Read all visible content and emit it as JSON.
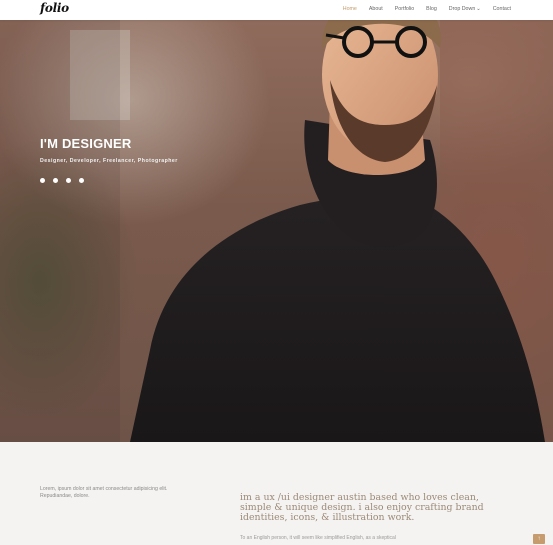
{
  "brand": {
    "logo": "folio"
  },
  "nav": {
    "items": [
      "Home",
      "About",
      "Portfolio",
      "Blog",
      "Drop Down",
      "Contact"
    ],
    "active": "Home",
    "dropdown_icon": "chevron-down-icon"
  },
  "hero": {
    "title": "I'M DESIGNER",
    "subtitle": "Designer, Developer, Freelancer, Photographer",
    "social_icons": [
      "facebook-icon",
      "twitter-icon",
      "instagram-icon",
      "email-icon"
    ]
  },
  "about": {
    "left_text": "Lorem, ipsum dolor sit amet consectetur adipisicing elit. Repudiandae, dolore.",
    "title": "im a ux /ui designer austin based who loves clean, simple & unique design. i also enjoy crafting brand identities, icons, & illustration work.",
    "small_text": "To an English person, it will seem like simplified English, as a skeptical"
  },
  "scroll_top": {
    "icon": "arrow-up-icon",
    "glyph": "↑"
  },
  "colors": {
    "accent": "#c69b6d",
    "title_brown": "#9c8a78",
    "page_bg": "#f4f3f1"
  }
}
